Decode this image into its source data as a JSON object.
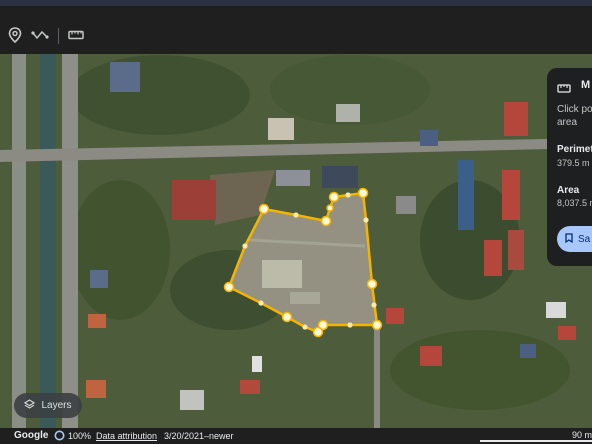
{
  "toolbar": {
    "icons": [
      "location-pin-icon",
      "path-icon",
      "ruler-icon"
    ]
  },
  "panel": {
    "title": "M",
    "instruction_line1": "Click poi",
    "instruction_line2": "area",
    "perimeter_label": "Perimete",
    "perimeter_value": "379.5 m",
    "area_label": "Area",
    "area_value": "8,037.5 m",
    "save_label": "Sa"
  },
  "layers": {
    "label": "Layers"
  },
  "bottom": {
    "brand": "Google",
    "zoom": "100%",
    "attribution": "Data attribution",
    "date": "3/20/2021–newer",
    "scale": "90 m"
  },
  "colors": {
    "polygon": "#f4b400",
    "accent": "#a8c7fa"
  }
}
